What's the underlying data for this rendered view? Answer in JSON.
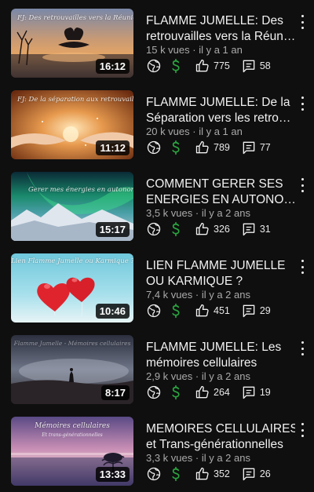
{
  "videos": [
    {
      "thumb_caption": "FJ: Des retrouvailles vers la Réunion",
      "duration": "16:12",
      "title_line1": "FLAMME JUMELLE: Des",
      "title_line2": "retrouvailles vers la Réun…",
      "views": "15 k vues",
      "age": "il y a 1 an",
      "likes": "775",
      "comments": "58"
    },
    {
      "thumb_caption": "FJ: De la séparation aux retrouvailles",
      "duration": "11:12",
      "title_line1": "FLAMME  JUMELLE: De la",
      "title_line2": "Séparation vers les retro…",
      "views": "20 k vues",
      "age": "il y a 1 an",
      "likes": "789",
      "comments": "77"
    },
    {
      "thumb_caption": "Gerer mes énergies en autonomie",
      "duration": "15:17",
      "title_line1": "COMMENT GERER SES",
      "title_line2": "ENERGIES EN AUTONO…",
      "views": "3,5 k vues",
      "age": "il y a 2 ans",
      "likes": "326",
      "comments": "31"
    },
    {
      "thumb_caption": "Lien Flamme Jumelle ou Karmique ?",
      "duration": "10:46",
      "title_line1": "LIEN FLAMME JUMELLE",
      "title_line2": "OU KARMIQUE ?",
      "views": "7,4 k vues",
      "age": "il y a 2 ans",
      "likes": "451",
      "comments": "29"
    },
    {
      "thumb_caption": "Flamme Jumelle - Mémoires cellulaires",
      "duration": "8:17",
      "title_line1": "FLAMME JUMELLE: Les",
      "title_line2": "mémoires cellulaires",
      "views": "2,9 k vues",
      "age": "il y a 2 ans",
      "likes": "264",
      "comments": "19"
    },
    {
      "thumb_caption": "Mémoires cellulaires",
      "thumb_sub": "Et trans-générationnelles",
      "duration": "13:33",
      "title_line1": "MEMOIRES CELLULAIRES",
      "title_line2": "et Trans-générationnelles",
      "views": "3,3 k vues",
      "age": "il y a 2 ans",
      "likes": "352",
      "comments": "26"
    }
  ],
  "separator": " · ",
  "colors": {
    "background": "#0f0f0f",
    "text_primary": "#f1f1f1",
    "text_secondary": "#aaaaaa",
    "monetization_green": "#2ba640"
  }
}
